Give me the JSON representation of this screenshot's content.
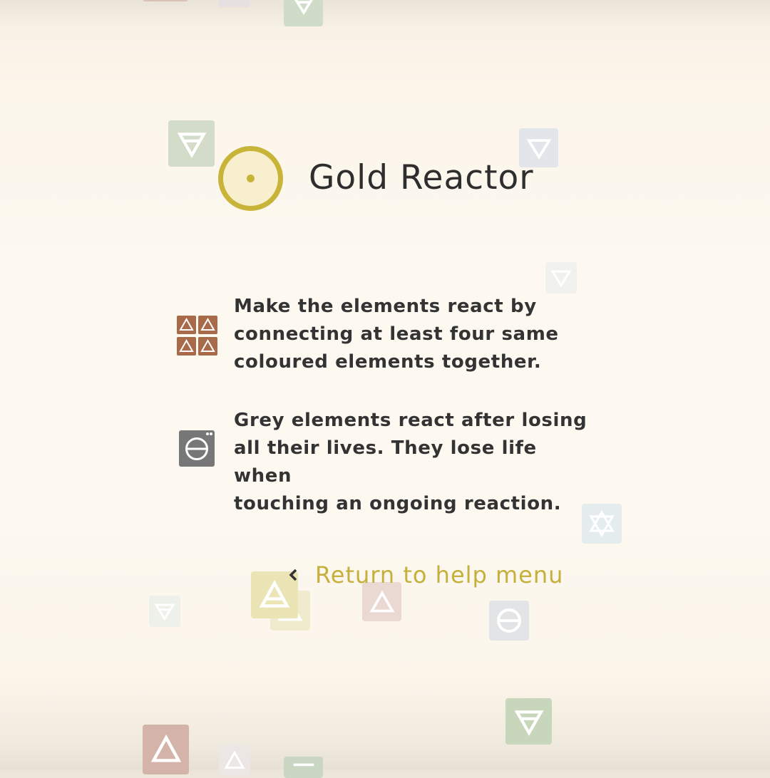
{
  "title": "Gold Reactor",
  "title_icon": "gold-reactor-icon",
  "instructions": [
    {
      "icon": "four-elements-icon",
      "line1": "Make the elements react by",
      "line2": "connecting at least four same",
      "line3": "coloured elements together."
    },
    {
      "icon": "grey-element-icon",
      "line1": "Grey elements react after losing",
      "line2": "all their lives. They lose life when",
      "line3": "touching an ongoing reaction."
    }
  ],
  "return_link": {
    "label": "Return to help menu",
    "icon": "chevron-left-icon"
  },
  "colors": {
    "accent_gold": "#c4b03a",
    "text": "#333333",
    "earth_brown": "#a86a48",
    "grey_element": "#777777",
    "background": "#fdf9f1"
  }
}
